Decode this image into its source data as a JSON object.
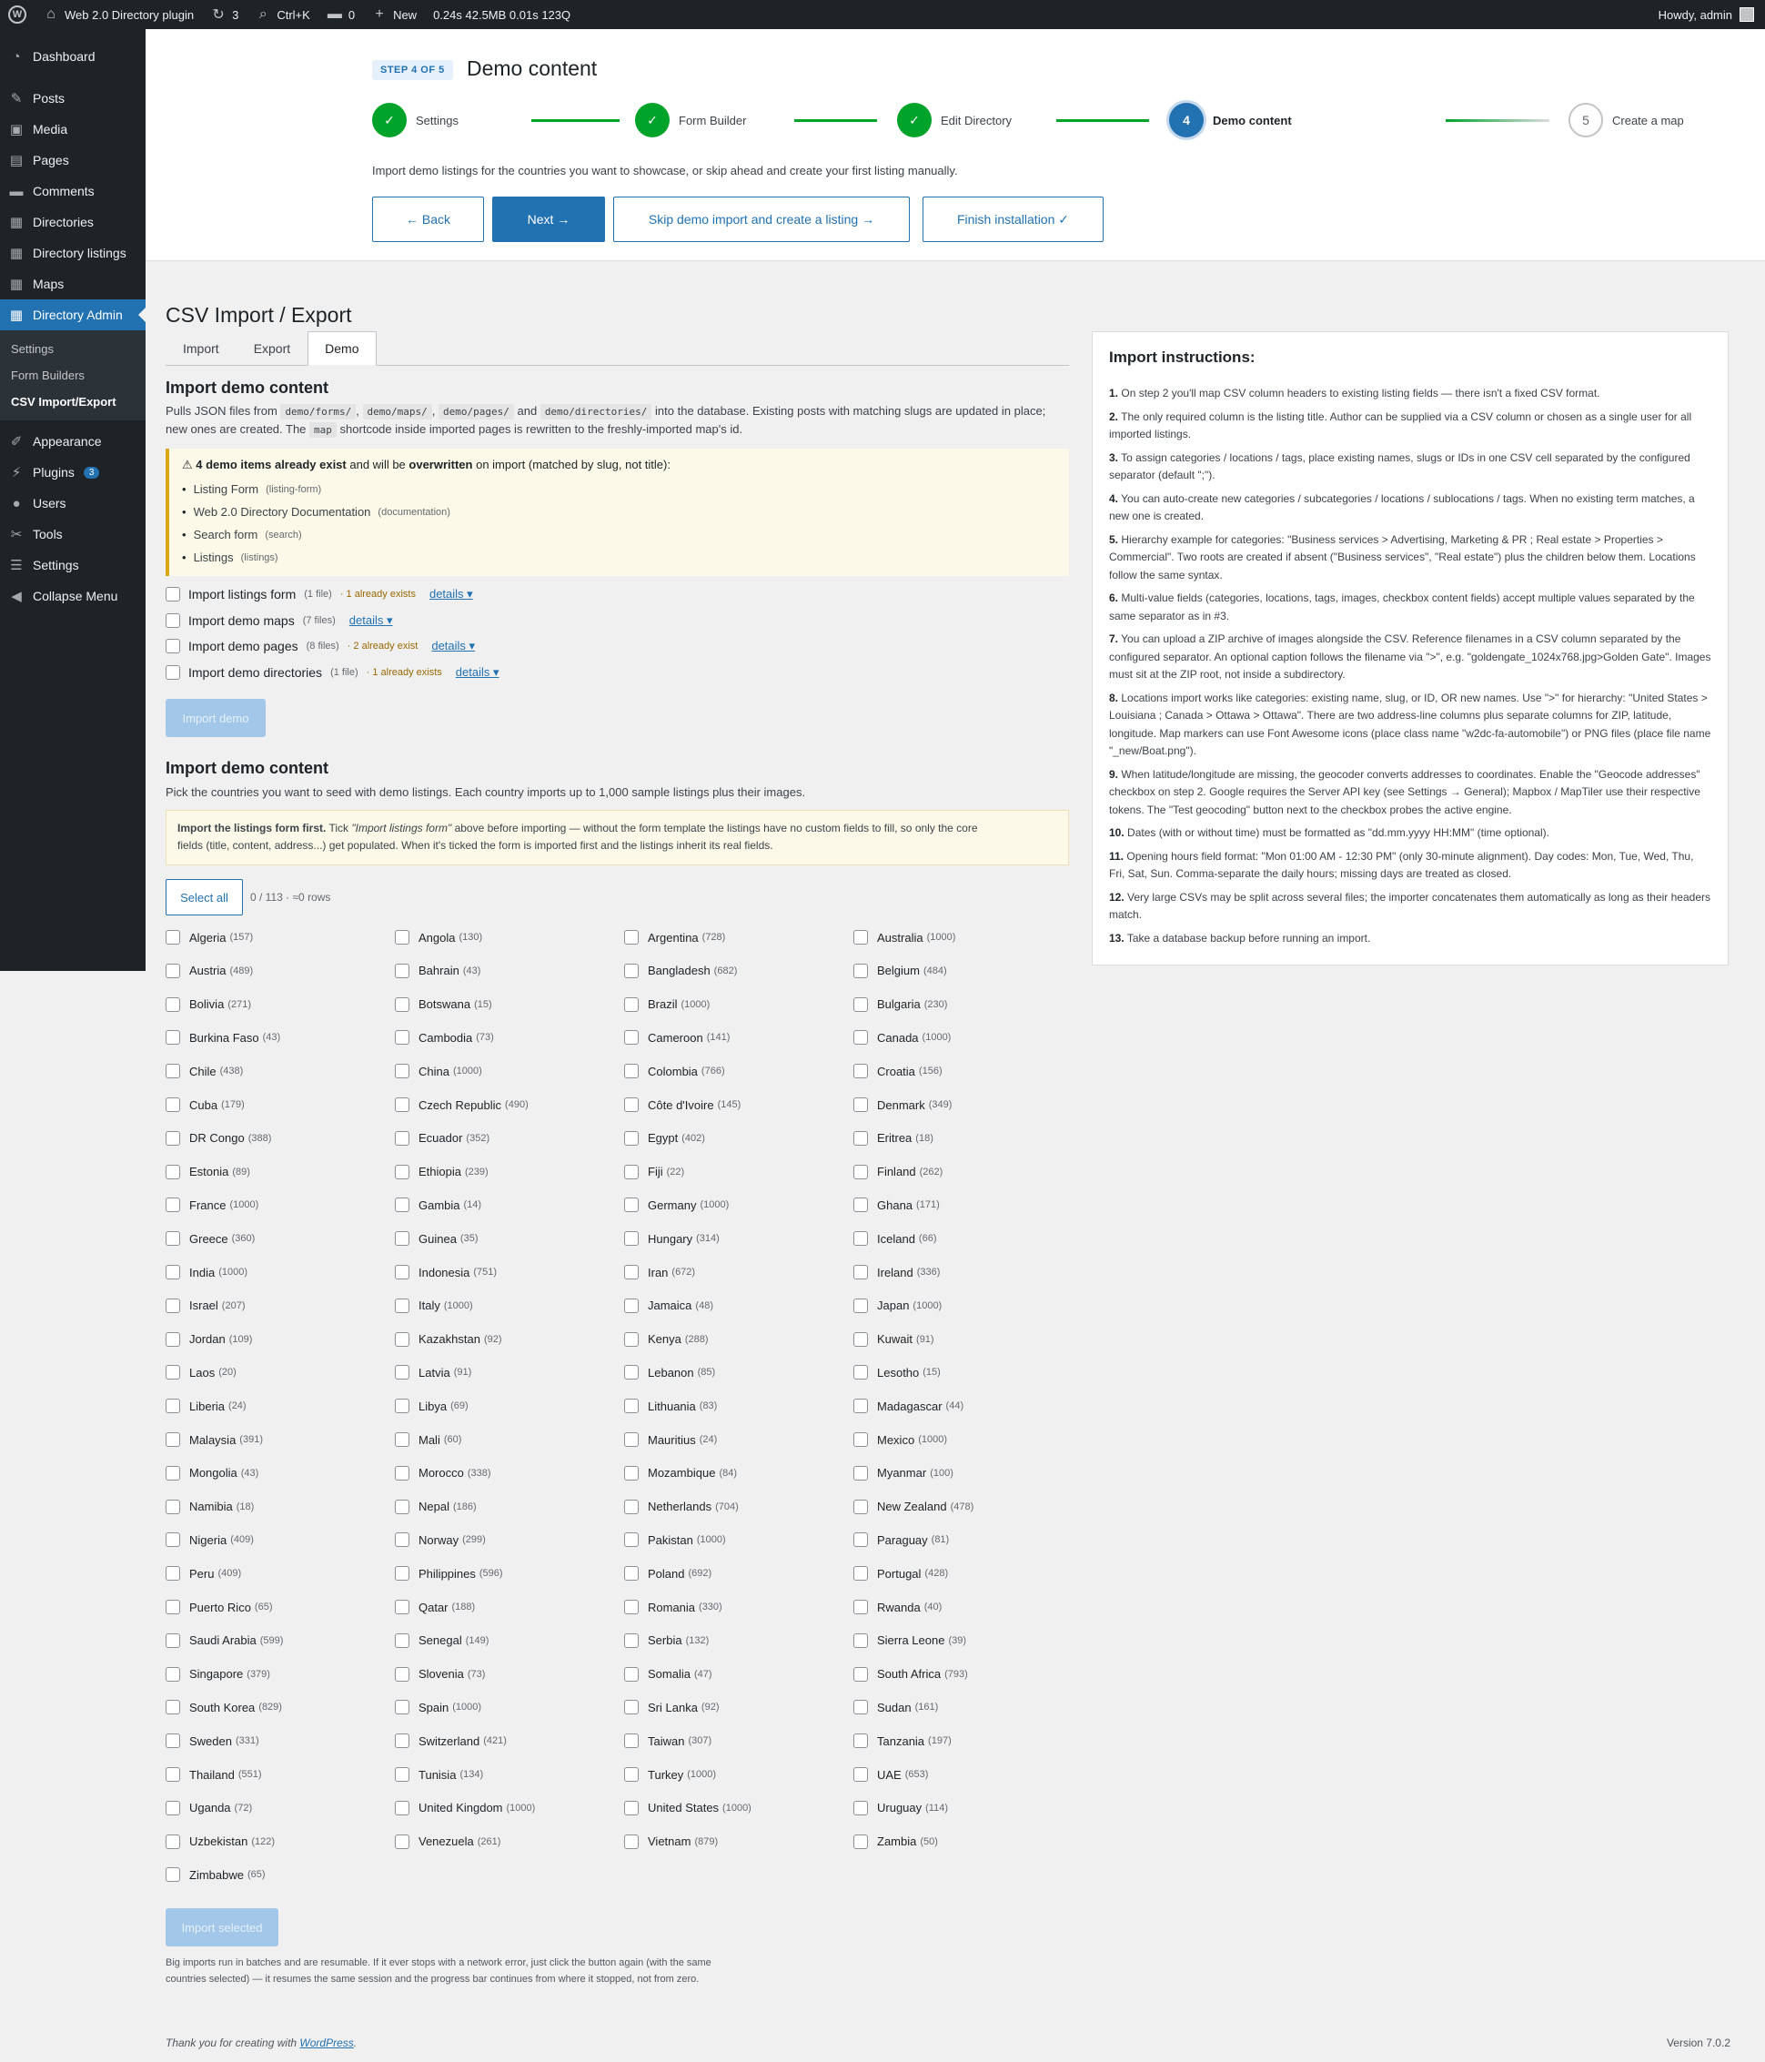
{
  "adminbar": {
    "site": "Web 2.0 Directory plugin",
    "updates": "3",
    "shortcut": "Ctrl+K",
    "comments": "0",
    "new": "New",
    "stats": "0.24s  42.5MB  0.01s  123Q",
    "howdy": "Howdy, admin"
  },
  "sidebar": {
    "items": [
      {
        "label": "Dashboard",
        "icon": "dashboard-icon"
      },
      {
        "label": "Posts",
        "icon": "pin-icon"
      },
      {
        "label": "Media",
        "icon": "media-icon"
      },
      {
        "label": "Pages",
        "icon": "page-icon"
      },
      {
        "label": "Comments",
        "icon": "comment-icon"
      },
      {
        "label": "Directories",
        "icon": "directory-icon"
      },
      {
        "label": "Directory listings",
        "icon": "directory-icon"
      },
      {
        "label": "Maps",
        "icon": "directory-icon"
      },
      {
        "label": "Directory Admin",
        "icon": "directory-icon"
      }
    ],
    "submenu": [
      "Settings",
      "Form Builders",
      "CSV Import/Export"
    ],
    "items2": [
      {
        "label": "Appearance",
        "icon": "brush-icon"
      },
      {
        "label": "Plugins",
        "icon": "plugin-icon",
        "badge": "3"
      },
      {
        "label": "Users",
        "icon": "user-icon"
      },
      {
        "label": "Tools",
        "icon": "wrench-icon"
      },
      {
        "label": "Settings",
        "icon": "settings-icon"
      },
      {
        "label": "Collapse Menu",
        "icon": "collapse-icon"
      }
    ]
  },
  "wizard": {
    "step_label": "STEP 4 OF 5",
    "title": "Demo content",
    "steps": [
      {
        "label": "Settings",
        "mark": "✓"
      },
      {
        "label": "Form Builder",
        "mark": "✓"
      },
      {
        "label": "Edit Directory",
        "mark": "✓"
      },
      {
        "label": "Demo content",
        "mark": "4"
      },
      {
        "label": "Create a map",
        "mark": "5"
      }
    ],
    "description": "Import demo listings for the countries you want to showcase, or skip ahead and create your first listing manually.",
    "back": "← Back",
    "next": "Next →",
    "skip": "Skip demo import and create a listing →",
    "finish": "Finish installation ✓"
  },
  "page": {
    "title": "CSV Import / Export",
    "tabs": [
      "Import",
      "Export",
      "Demo"
    ],
    "demo_heading": "Import demo content",
    "demo_desc_1a": "Pulls JSON files from",
    "codes": [
      "demo/forms/",
      "demo/maps/",
      "demo/pages/",
      "demo/directories/"
    ],
    "and": "and",
    "demo_desc_1b": "into the database. Existing posts with matching slugs are updated in place;",
    "demo_desc_2a": "new ones are created. The",
    "code_map": "map",
    "demo_desc_2b": "shortcode inside imported pages is rewritten to the freshly-imported map's id.",
    "warning_pre": "⚠ 4 demo items already exist",
    "warning_mid": " and will be ",
    "warning_bold": "overwritten",
    "warning_post": " on import (matched by slug, not title):",
    "existing": [
      {
        "name": "Listing Form",
        "slug": "(listing-form)"
      },
      {
        "name": "Web 2.0 Directory Documentation",
        "slug": "(documentation)"
      },
      {
        "name": "Search form",
        "slug": "(search)"
      },
      {
        "name": "Listings",
        "slug": "(listings)"
      }
    ],
    "imports": [
      {
        "label": "Import listings form",
        "files": "(1 file)",
        "exists": "· 1 already exists",
        "details": "details ▾"
      },
      {
        "label": "Import demo maps",
        "files": "(7 files)",
        "exists": "",
        "details": "details ▾"
      },
      {
        "label": "Import demo pages",
        "files": "(8 files)",
        "exists": "· 2 already exist",
        "details": "details ▾"
      },
      {
        "label": "Import demo directories",
        "files": "(1 file)",
        "exists": "· 1 already exists",
        "details": "details ▾"
      }
    ],
    "import_demo_button": "Import demo",
    "listings_heading": "Import demo content",
    "listings_desc": "Pick the countries you want to seed with demo listings. Each country imports up to 1,000 sample listings plus their images.",
    "info_bold": "Import the listings form first.",
    "info_pre": " Tick ",
    "info_italic": "\"Import listings form\"",
    "info_post": " above before importing — without the form template the listings have no custom fields to fill, so only the core",
    "info_line2": "fields (title, content, address...) get populated. When it's ticked the form is imported first and the listings inherit its real fields.",
    "select_all": "Select all",
    "row_count": "0 / 113 · ≈0 rows",
    "countries": [
      [
        "Algeria",
        "(157)"
      ],
      [
        "Angola",
        "(130)"
      ],
      [
        "Argentina",
        "(728)"
      ],
      [
        "Australia",
        "(1000)"
      ],
      [
        "Austria",
        "(489)"
      ],
      [
        "Bahrain",
        "(43)"
      ],
      [
        "Bangladesh",
        "(682)"
      ],
      [
        "Belgium",
        "(484)"
      ],
      [
        "Bolivia",
        "(271)"
      ],
      [
        "Botswana",
        "(15)"
      ],
      [
        "Brazil",
        "(1000)"
      ],
      [
        "Bulgaria",
        "(230)"
      ],
      [
        "Burkina Faso",
        "(43)"
      ],
      [
        "Cambodia",
        "(73)"
      ],
      [
        "Cameroon",
        "(141)"
      ],
      [
        "Canada",
        "(1000)"
      ],
      [
        "Chile",
        "(438)"
      ],
      [
        "China",
        "(1000)"
      ],
      [
        "Colombia",
        "(766)"
      ],
      [
        "Croatia",
        "(156)"
      ],
      [
        "Cuba",
        "(179)"
      ],
      [
        "Czech Republic",
        "(490)"
      ],
      [
        "Côte d'Ivoire",
        "(145)"
      ],
      [
        "Denmark",
        "(349)"
      ],
      [
        "DR Congo",
        "(388)"
      ],
      [
        "Ecuador",
        "(352)"
      ],
      [
        "Egypt",
        "(402)"
      ],
      [
        "Eritrea",
        "(18)"
      ],
      [
        "Estonia",
        "(89)"
      ],
      [
        "Ethiopia",
        "(239)"
      ],
      [
        "Fiji",
        "(22)"
      ],
      [
        "Finland",
        "(262)"
      ],
      [
        "France",
        "(1000)"
      ],
      [
        "Gambia",
        "(14)"
      ],
      [
        "Germany",
        "(1000)"
      ],
      [
        "Ghana",
        "(171)"
      ],
      [
        "Greece",
        "(360)"
      ],
      [
        "Guinea",
        "(35)"
      ],
      [
        "Hungary",
        "(314)"
      ],
      [
        "Iceland",
        "(66)"
      ],
      [
        "India",
        "(1000)"
      ],
      [
        "Indonesia",
        "(751)"
      ],
      [
        "Iran",
        "(672)"
      ],
      [
        "Ireland",
        "(336)"
      ],
      [
        "Israel",
        "(207)"
      ],
      [
        "Italy",
        "(1000)"
      ],
      [
        "Jamaica",
        "(48)"
      ],
      [
        "Japan",
        "(1000)"
      ],
      [
        "Jordan",
        "(109)"
      ],
      [
        "Kazakhstan",
        "(92)"
      ],
      [
        "Kenya",
        "(288)"
      ],
      [
        "Kuwait",
        "(91)"
      ],
      [
        "Laos",
        "(20)"
      ],
      [
        "Latvia",
        "(91)"
      ],
      [
        "Lebanon",
        "(85)"
      ],
      [
        "Lesotho",
        "(15)"
      ],
      [
        "Liberia",
        "(24)"
      ],
      [
        "Libya",
        "(69)"
      ],
      [
        "Lithuania",
        "(83)"
      ],
      [
        "Madagascar",
        "(44)"
      ],
      [
        "Malaysia",
        "(391)"
      ],
      [
        "Mali",
        "(60)"
      ],
      [
        "Mauritius",
        "(24)"
      ],
      [
        "Mexico",
        "(1000)"
      ],
      [
        "Mongolia",
        "(43)"
      ],
      [
        "Morocco",
        "(338)"
      ],
      [
        "Mozambique",
        "(84)"
      ],
      [
        "Myanmar",
        "(100)"
      ],
      [
        "Namibia",
        "(18)"
      ],
      [
        "Nepal",
        "(186)"
      ],
      [
        "Netherlands",
        "(704)"
      ],
      [
        "New Zealand",
        "(478)"
      ],
      [
        "Nigeria",
        "(409)"
      ],
      [
        "Norway",
        "(299)"
      ],
      [
        "Pakistan",
        "(1000)"
      ],
      [
        "Paraguay",
        "(81)"
      ],
      [
        "Peru",
        "(409)"
      ],
      [
        "Philippines",
        "(596)"
      ],
      [
        "Poland",
        "(692)"
      ],
      [
        "Portugal",
        "(428)"
      ],
      [
        "Puerto Rico",
        "(65)"
      ],
      [
        "Qatar",
        "(188)"
      ],
      [
        "Romania",
        "(330)"
      ],
      [
        "Rwanda",
        "(40)"
      ],
      [
        "Saudi Arabia",
        "(599)"
      ],
      [
        "Senegal",
        "(149)"
      ],
      [
        "Serbia",
        "(132)"
      ],
      [
        "Sierra Leone",
        "(39)"
      ],
      [
        "Singapore",
        "(379)"
      ],
      [
        "Slovenia",
        "(73)"
      ],
      [
        "Somalia",
        "(47)"
      ],
      [
        "South Africa",
        "(793)"
      ],
      [
        "South Korea",
        "(829)"
      ],
      [
        "Spain",
        "(1000)"
      ],
      [
        "Sri Lanka",
        "(92)"
      ],
      [
        "Sudan",
        "(161)"
      ],
      [
        "Sweden",
        "(331)"
      ],
      [
        "Switzerland",
        "(421)"
      ],
      [
        "Taiwan",
        "(307)"
      ],
      [
        "Tanzania",
        "(197)"
      ],
      [
        "Thailand",
        "(551)"
      ],
      [
        "Tunisia",
        "(134)"
      ],
      [
        "Turkey",
        "(1000)"
      ],
      [
        "UAE",
        "(653)"
      ],
      [
        "Uganda",
        "(72)"
      ],
      [
        "United Kingdom",
        "(1000)"
      ],
      [
        "United States",
        "(1000)"
      ],
      [
        "Uruguay",
        "(114)"
      ],
      [
        "Uzbekistan",
        "(122)"
      ],
      [
        "Venezuela",
        "(261)"
      ],
      [
        "Vietnam",
        "(879)"
      ],
      [
        "Zambia",
        "(50)"
      ],
      [
        "Zimbabwe",
        "(65)"
      ]
    ],
    "import_selected_button": "Import selected",
    "note": "Big imports run in batches and are resumable. If it ever stops with a network error, just click the button again (with the same countries selected) — it resumes the same session and the progress bar continues from where it stopped, not from zero.",
    "footer_text": "Thank you for creating with",
    "footer_link": "WordPress",
    "footer_dot": ".",
    "version": "Version 7.0.2"
  },
  "instructions": {
    "title": "Import instructions:",
    "items": [
      {
        "n": "1.",
        "t": "On step 2 you'll map CSV column headers to existing listing fields — there isn't a fixed CSV format."
      },
      {
        "n": "2.",
        "t": "The only required column is the listing title. Author can be supplied via a CSV column or chosen as a single user for all imported listings."
      },
      {
        "n": "3.",
        "t": "To assign categories / locations / tags, place existing names, slugs or IDs in one CSV cell separated by the configured separator (default \";\")."
      },
      {
        "n": "4.",
        "t": "You can auto-create new categories / subcategories / locations / sublocations / tags. When no existing term matches, a new one is created."
      },
      {
        "n": "5.",
        "t": "Hierarchy example for categories: \"Business services > Advertising, Marketing & PR ; Real estate > Properties > Commercial\". Two roots are created if absent (\"Business services\", \"Real estate\") plus the children below them. Locations follow the same syntax."
      },
      {
        "n": "6.",
        "t": "Multi-value fields (categories, locations, tags, images, checkbox content fields) accept multiple values separated by the same separator as in #3."
      },
      {
        "n": "7.",
        "t": "You can upload a ZIP archive of images alongside the CSV. Reference filenames in a CSV column separated by the configured separator. An optional caption follows the filename via \">\", e.g. \"goldengate_1024x768.jpg>Golden Gate\". Images must sit at the ZIP root, not inside a subdirectory."
      },
      {
        "n": "8.",
        "t": "Locations import works like categories: existing name, slug, or ID, OR new names. Use \">\" for hierarchy: \"United States > Louisiana ; Canada > Ottawa > Ottawa\". There are two address-line columns plus separate columns for ZIP, latitude, longitude. Map markers can use Font Awesome icons (place class name \"w2dc-fa-automobile\") or PNG files (place file name \"_new/Boat.png\")."
      },
      {
        "n": "9.",
        "t": "When latitude/longitude are missing, the geocoder converts addresses to coordinates. Enable the \"Geocode addresses\" checkbox on step 2. Google requires the Server API key (see Settings → General); Mapbox / MapTiler use their respective tokens. The \"Test geocoding\" button next to the checkbox probes the active engine."
      },
      {
        "n": "10.",
        "t": "Dates (with or without time) must be formatted as \"dd.mm.yyyy HH:MM\" (time optional)."
      },
      {
        "n": "11.",
        "t": "Opening hours field format: \"Mon 01:00 AM - 12:30 PM\" (only 30-minute alignment). Day codes: Mon, Tue, Wed, Thu, Fri, Sat, Sun. Comma-separate the daily hours; missing days are treated as closed."
      },
      {
        "n": "12.",
        "t": "Very large CSVs may be split across several files; the importer concatenates them automatically as long as their headers match."
      },
      {
        "n": "13.",
        "t": "Take a database backup before running an import."
      }
    ]
  }
}
